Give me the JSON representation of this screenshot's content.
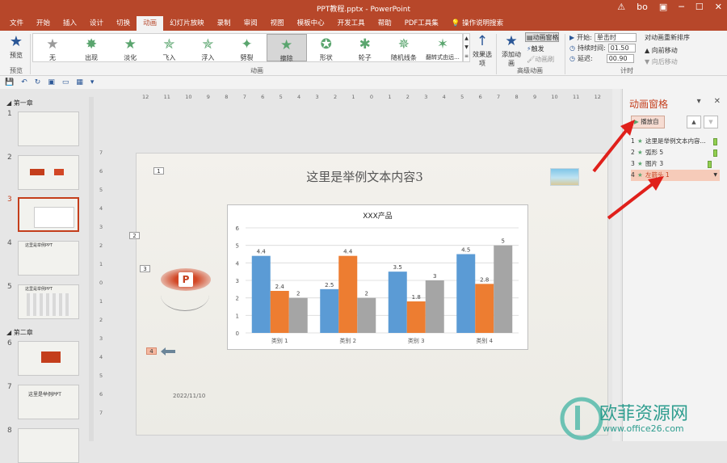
{
  "window": {
    "title": "PPT教程.pptx  -  PowerPoint",
    "user": "bo"
  },
  "tabs": [
    "文件",
    "开始",
    "插入",
    "设计",
    "切换",
    "动画",
    "幻灯片放映",
    "录制",
    "审阅",
    "视图",
    "模板中心",
    "开发工具",
    "帮助",
    "PDF工具集",
    "操作说明搜索"
  ],
  "ribbon": {
    "preview_label": "预览",
    "preview_group": "预览",
    "animations": [
      "无",
      "出现",
      "淡化",
      "飞入",
      "浮入",
      "劈裂",
      "擦除",
      "形状",
      "轮子",
      "随机线条",
      "翻转式由远..."
    ],
    "animation_group": "动画",
    "effect_options": "效果选项",
    "add_animation": "添加动画",
    "anim_pane_btn": "动画窗格",
    "trigger": "触发",
    "anim_painter": "动画刷",
    "advanced_group": "高级动画",
    "start_label": "开始:",
    "start_value": "单击时",
    "duration_label": "持续时间:",
    "duration_value": "01.50",
    "delay_label": "延迟:",
    "delay_value": "00.90",
    "reorder_label": "对动画重新排序",
    "move_earlier": "向前移动",
    "move_later": "向后移动",
    "timing_group": "计时"
  },
  "thumbnails": {
    "section1": "第一章",
    "section2": "第二章",
    "slides": [
      "1",
      "2",
      "3",
      "4",
      "5",
      "6",
      "7",
      "8"
    ],
    "current": "3",
    "captions": {
      "s4": "这里是举例PPT",
      "s5": "这里是举例PPT",
      "s7": "这里是举例PPT"
    }
  },
  "ruler": {
    "h": [
      "12",
      "11",
      "10",
      "9",
      "8",
      "7",
      "6",
      "5",
      "4",
      "3",
      "2",
      "1",
      "0",
      "1",
      "2",
      "3",
      "4",
      "5",
      "6",
      "7",
      "8",
      "9",
      "10",
      "11",
      "12"
    ],
    "v": [
      "7",
      "6",
      "5",
      "4",
      "3",
      "2",
      "1",
      "0",
      "1",
      "2",
      "3",
      "4",
      "5",
      "6",
      "7"
    ]
  },
  "slide": {
    "title": "这里是举例文本内容3",
    "date": "2022/11/10",
    "markers": [
      "1",
      "2",
      "3",
      "4"
    ]
  },
  "chart_data": {
    "type": "bar",
    "title": "XXX产品",
    "categories": [
      "类别 1",
      "类别 2",
      "类别 3",
      "类别 4"
    ],
    "series": [
      {
        "values": [
          4.4,
          2.5,
          3.5,
          4.5
        ],
        "color": "#5b9bd5"
      },
      {
        "values": [
          2.4,
          4.4,
          1.8,
          2.8
        ],
        "color": "#ed7d31"
      },
      {
        "values": [
          2,
          2,
          3,
          5
        ],
        "color": "#a5a5a5"
      }
    ],
    "ylim": [
      0,
      6
    ],
    "yticks": [
      "0",
      "1",
      "2",
      "3",
      "4",
      "5",
      "6"
    ],
    "grid": true
  },
  "pane": {
    "title": "动画窗格",
    "play_label": "播放自",
    "items": [
      {
        "num": "1",
        "label": "这里是举例文本内容..."
      },
      {
        "num": "2",
        "label": "弧形 5"
      },
      {
        "num": "3",
        "label": "图片 3"
      },
      {
        "num": "4",
        "label": "左箭头 1"
      }
    ]
  },
  "watermark": {
    "text_cn": "欧菲资源网",
    "text_url": "www.office26.com"
  },
  "colors": {
    "accent": "#b7472a",
    "selection": "#c43e1c",
    "arrow_red": "#e0201b"
  }
}
